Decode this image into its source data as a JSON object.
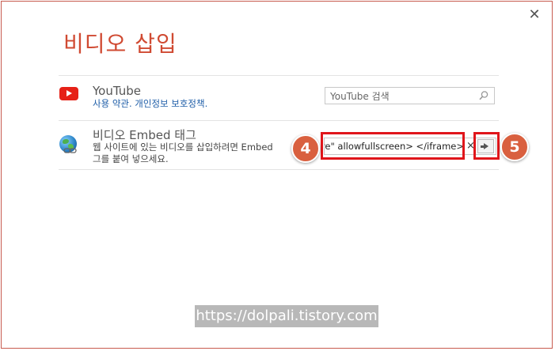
{
  "dialog": {
    "title": "비디오 삽입",
    "close_glyph": "✕"
  },
  "youtube": {
    "icon": "youtube-icon",
    "title": "YouTube",
    "terms_link": "사용 약관",
    "separator": ". ",
    "privacy_link": "개인정보 보호정책",
    "end": ".",
    "search_placeholder": "YouTube 검색",
    "search_icon": "search-icon"
  },
  "embed": {
    "icon": "globe-link-icon",
    "title": "비디오 Embed 태그",
    "description_line1": "웹 사이트에 있는 비디오를 삽입하려면 Embed",
    "description_line2": "그를 붙여 넣으세요.",
    "input_value": "hare\" allowfullscreen> </iframe>",
    "clear_glyph": "×",
    "go_icon": "arrow-right-icon"
  },
  "annotations": {
    "step4": "4",
    "step5": "5",
    "highlight_color": "#e0161b",
    "badge_color": "#d9603f"
  },
  "watermark": "https://dolpali.tistory.com"
}
